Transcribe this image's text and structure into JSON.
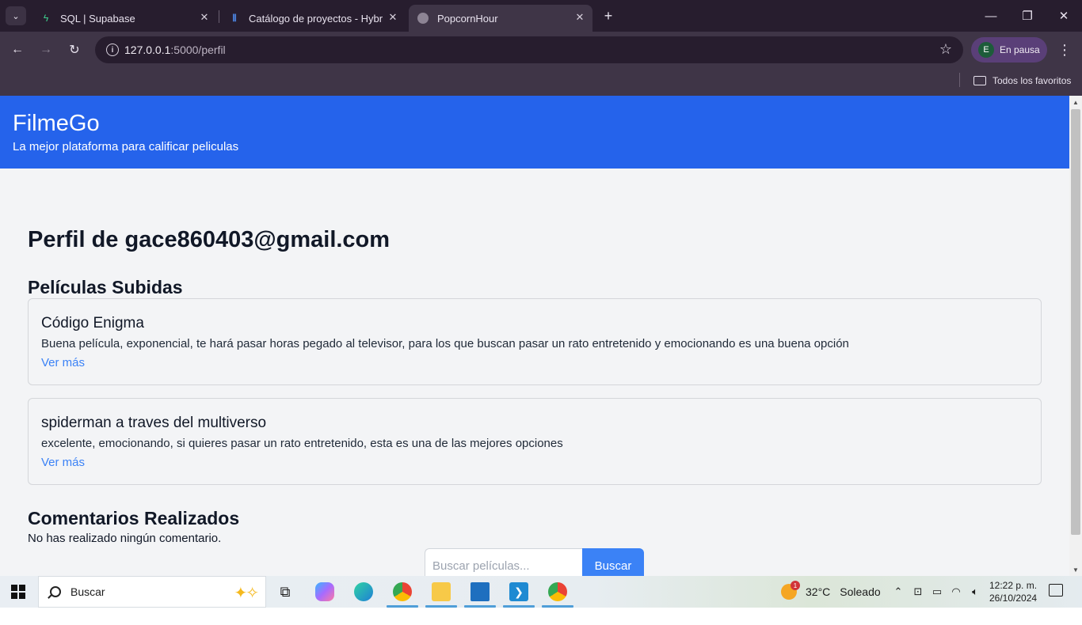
{
  "browser": {
    "tabs": [
      {
        "title": "SQL | Supabase",
        "active": false
      },
      {
        "title": "Catálogo de proyectos - Hybrid",
        "active": false
      },
      {
        "title": "PopcornHour",
        "active": true
      }
    ],
    "url_host": "127.0.0.1",
    "url_path": ":5000/perfil",
    "profile_initial": "E",
    "profile_label": "En pausa",
    "bookmarks_folder": "Todos los favoritos"
  },
  "site": {
    "title": "FilmeGo",
    "subtitle": "La mejor plataforma para calificar peliculas"
  },
  "profile": {
    "heading": "Perfil de gace860403@gmail.com",
    "uploaded_heading": "Películas Subidas",
    "movies": [
      {
        "title": "Código Enigma",
        "description": "Buena película, exponencial, te hará pasar horas pegado al televisor, para los que buscan pasar un rato entretenido y emocionando es una buena opción",
        "link": "Ver más"
      },
      {
        "title": "spiderman a traves del multiverso",
        "description": "excelente, emocionando, si quieres pasar un rato entretenido, esta es una de las mejores opciones",
        "link": "Ver más"
      }
    ],
    "comments_heading": "Comentarios Realizados",
    "no_comments": "No has realizado ningún comentario."
  },
  "search": {
    "placeholder": "Buscar películas...",
    "button": "Buscar"
  },
  "taskbar": {
    "search_label": "Buscar",
    "weather_temp": "32°C",
    "weather_condition": "Soleado",
    "weather_badge": "1",
    "time": "12:22 p. m.",
    "date": "26/10/2024"
  },
  "colors": {
    "header_blue": "#2563eb",
    "link_blue": "#3b82f6",
    "page_bg": "#f3f4f6"
  }
}
